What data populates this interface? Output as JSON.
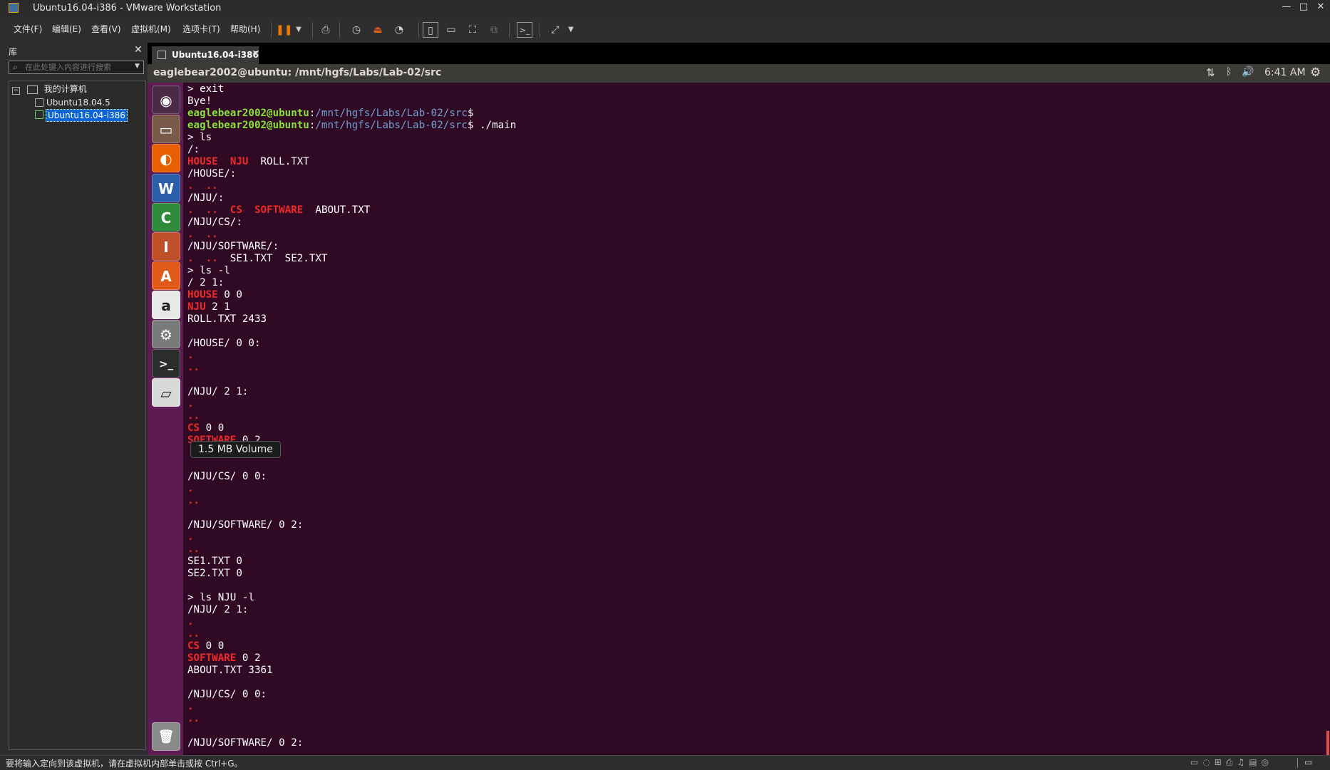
{
  "window": {
    "title": "Ubuntu16.04-i386 - VMware Workstation",
    "minimize": "—",
    "maximize": "□",
    "close": "✕"
  },
  "menu": {
    "file": "文件(F)",
    "edit": "编辑(E)",
    "view": "查看(V)",
    "vm": "虚拟机(M)",
    "tabs": "选项卡(T)",
    "help": "帮助(H)"
  },
  "toolbar_icons": [
    "pause-icon",
    "dropdown-icon",
    "send-keys-icon",
    "snapshot-icon",
    "revert-snapshot-icon",
    "snapshot-manager-icon",
    "library-view-icon",
    "thumbnail-view-icon",
    "fullscreen-icon",
    "unity-icon",
    "console-icon",
    "stretch-icon"
  ],
  "library": {
    "header": "库",
    "close": "✕",
    "search_placeholder": "在此处键入内容进行搜索",
    "root": "我的计算机",
    "items": [
      {
        "label": "Ubuntu18.04.5",
        "selected": false
      },
      {
        "label": "Ubuntu16.04-i386",
        "selected": true
      }
    ]
  },
  "vm_tab": {
    "label": "Ubuntu16.04-i386",
    "close": "✕"
  },
  "guest_top": {
    "title": "eaglebear2002@ubuntu: /mnt/hgfs/Labs/Lab-02/src",
    "time": "6:41 AM"
  },
  "launcher": [
    {
      "name": "dash-home",
      "glyph": "◉",
      "color": "#4a2a46"
    },
    {
      "name": "files",
      "glyph": "▭",
      "color": "#7a5a48"
    },
    {
      "name": "firefox",
      "glyph": "◐",
      "color": "#e66000"
    },
    {
      "name": "libreoffice-writer",
      "glyph": "W",
      "color": "#2a5ea8"
    },
    {
      "name": "libreoffice-calc",
      "glyph": "C",
      "color": "#2e8a3a"
    },
    {
      "name": "libreoffice-impress",
      "glyph": "I",
      "color": "#c0502a"
    },
    {
      "name": "software-center",
      "glyph": "A",
      "color": "#e05a1a"
    },
    {
      "name": "amazon",
      "glyph": "a",
      "color": "#e8e8e8"
    },
    {
      "name": "system-settings",
      "glyph": "⚙",
      "color": "#7a7a7a"
    },
    {
      "name": "terminal",
      "glyph": ">_",
      "color": "#2c2c2c"
    },
    {
      "name": "volume",
      "glyph": "▱",
      "color": "#d8d8d8"
    }
  ],
  "launcher_trash": {
    "name": "trash",
    "glyph": "🗑",
    "color": "#8a8a8a"
  },
  "tooltip": "1.5 MB Volume",
  "terminal_lines": [
    [
      {
        "t": "> exit"
      }
    ],
    [
      {
        "t": "Bye!"
      }
    ],
    [
      {
        "t": "eaglebear2002@ubuntu",
        "c": "g"
      },
      {
        "t": ":"
      },
      {
        "t": "/mnt/hgfs/Labs/Lab-02/src",
        "c": "b"
      },
      {
        "t": "$"
      }
    ],
    [
      {
        "t": "eaglebear2002@ubuntu",
        "c": "g"
      },
      {
        "t": ":"
      },
      {
        "t": "/mnt/hgfs/Labs/Lab-02/src",
        "c": "b"
      },
      {
        "t": "$ ./main"
      }
    ],
    [
      {
        "t": "> ls"
      }
    ],
    [
      {
        "t": "/:"
      }
    ],
    [
      {
        "t": "HOUSE",
        "c": "r"
      },
      {
        "t": "  "
      },
      {
        "t": "NJU",
        "c": "r"
      },
      {
        "t": "  ROLL.TXT"
      }
    ],
    [
      {
        "t": "/HOUSE/:"
      }
    ],
    [
      {
        "t": ".  ..",
        "c": "r"
      }
    ],
    [
      {
        "t": "/NJU/:"
      }
    ],
    [
      {
        "t": ".  ..  ",
        "c": "r"
      },
      {
        "t": "CS",
        "c": "r"
      },
      {
        "t": "  "
      },
      {
        "t": "SOFTWARE",
        "c": "r"
      },
      {
        "t": "  ABOUT.TXT"
      }
    ],
    [
      {
        "t": "/NJU/CS/:"
      }
    ],
    [
      {
        "t": ".  ..",
        "c": "r"
      }
    ],
    [
      {
        "t": "/NJU/SOFTWARE/:"
      }
    ],
    [
      {
        "t": ".  ..",
        "c": "r"
      },
      {
        "t": "  SE1.TXT  SE2.TXT"
      }
    ],
    [
      {
        "t": "> ls -l"
      }
    ],
    [
      {
        "t": "/ 2 1:"
      }
    ],
    [
      {
        "t": "HOUSE",
        "c": "r"
      },
      {
        "t": " 0 0"
      }
    ],
    [
      {
        "t": "NJU",
        "c": "r"
      },
      {
        "t": " 2 1"
      }
    ],
    [
      {
        "t": "ROLL.TXT 2433"
      }
    ],
    [
      {
        "t": ""
      }
    ],
    [
      {
        "t": "/HOUSE/ 0 0:"
      }
    ],
    [
      {
        "t": ".",
        "c": "r"
      }
    ],
    [
      {
        "t": "..",
        "c": "r"
      }
    ],
    [
      {
        "t": ""
      }
    ],
    [
      {
        "t": "/NJU/ 2 1:"
      }
    ],
    [
      {
        "t": ".",
        "c": "r"
      }
    ],
    [
      {
        "t": "..",
        "c": "r"
      }
    ],
    [
      {
        "t": "CS",
        "c": "r"
      },
      {
        "t": " 0 0"
      }
    ],
    [
      {
        "t": "SOFTWARE",
        "c": "r"
      },
      {
        "t": " 0 2"
      }
    ],
    [
      {
        "t": ""
      }
    ],
    [
      {
        "t": ""
      }
    ],
    [
      {
        "t": "/NJU/CS/ 0 0:"
      }
    ],
    [
      {
        "t": ".",
        "c": "r"
      }
    ],
    [
      {
        "t": "..",
        "c": "r"
      }
    ],
    [
      {
        "t": ""
      }
    ],
    [
      {
        "t": "/NJU/SOFTWARE/ 0 2:"
      }
    ],
    [
      {
        "t": ".",
        "c": "r"
      }
    ],
    [
      {
        "t": "..",
        "c": "r"
      }
    ],
    [
      {
        "t": "SE1.TXT 0"
      }
    ],
    [
      {
        "t": "SE2.TXT 0"
      }
    ],
    [
      {
        "t": ""
      }
    ],
    [
      {
        "t": "> ls NJU -l"
      }
    ],
    [
      {
        "t": "/NJU/ 2 1:"
      }
    ],
    [
      {
        "t": ".",
        "c": "r"
      }
    ],
    [
      {
        "t": "..",
        "c": "r"
      }
    ],
    [
      {
        "t": "CS",
        "c": "r"
      },
      {
        "t": " 0 0"
      }
    ],
    [
      {
        "t": "SOFTWARE",
        "c": "r"
      },
      {
        "t": " 0 2"
      }
    ],
    [
      {
        "t": "ABOUT.TXT 3361"
      }
    ],
    [
      {
        "t": ""
      }
    ],
    [
      {
        "t": "/NJU/CS/ 0 0:"
      }
    ],
    [
      {
        "t": ".",
        "c": "r"
      }
    ],
    [
      {
        "t": "..",
        "c": "r"
      }
    ],
    [
      {
        "t": ""
      }
    ],
    [
      {
        "t": "/NJU/SOFTWARE/ 0 2:"
      }
    ]
  ],
  "statusbar": {
    "text": "要将输入定向到该虚拟机，请在虚拟机内部单击或按 Ctrl+G。"
  }
}
